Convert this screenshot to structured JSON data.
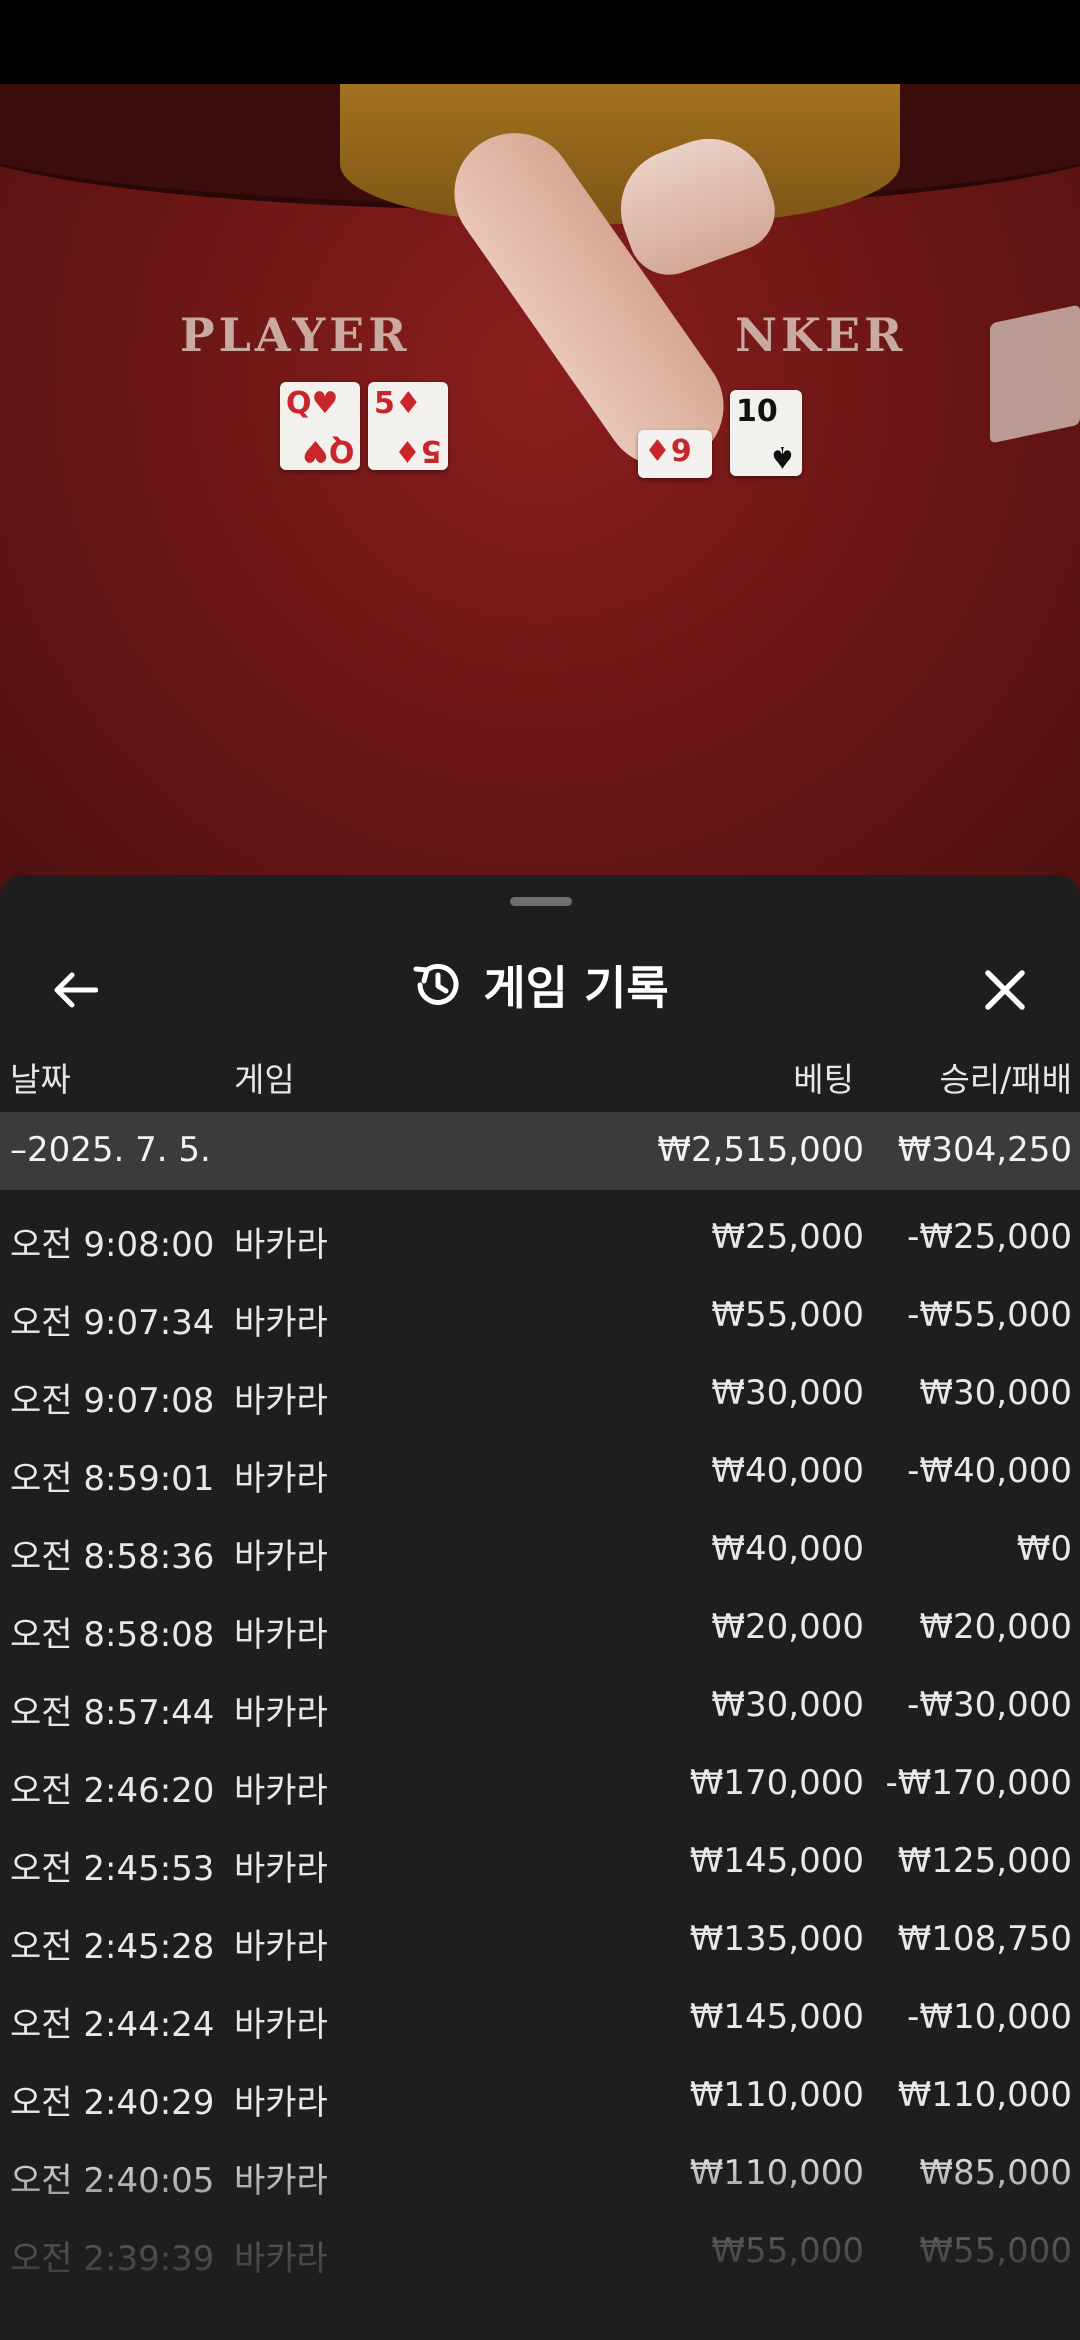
{
  "table": {
    "player_label": "PLAYER",
    "banker_label": "NKER",
    "player_cards": [
      {
        "rank": "Q",
        "suit": "♥",
        "color": "red"
      },
      {
        "rank": "5",
        "suit": "♦",
        "color": "red"
      }
    ],
    "banker_cards": [
      {
        "rank": "9",
        "suit": "♦",
        "color": "red"
      },
      {
        "rank": "10",
        "suit": "♠",
        "color": "black"
      }
    ]
  },
  "sheet": {
    "title": "게임 기록",
    "icons": {
      "back": "arrow-left-icon",
      "history": "history-icon",
      "close": "close-icon"
    }
  },
  "columns": {
    "date": "날짜",
    "game": "게임",
    "bet": "베팅",
    "result": "승리/패배"
  },
  "summary": {
    "date": "–2025. 7. 5.",
    "bet": "₩2,515,000",
    "result": "₩304,250"
  },
  "rows": [
    {
      "time": "오전 9:08:00",
      "game": "바카라",
      "bet": "₩25,000",
      "result": "-₩25,000"
    },
    {
      "time": "오전 9:07:34",
      "game": "바카라",
      "bet": "₩55,000",
      "result": "-₩55,000"
    },
    {
      "time": "오전 9:07:08",
      "game": "바카라",
      "bet": "₩30,000",
      "result": "₩30,000"
    },
    {
      "time": "오전 8:59:01",
      "game": "바카라",
      "bet": "₩40,000",
      "result": "-₩40,000"
    },
    {
      "time": "오전 8:58:36",
      "game": "바카라",
      "bet": "₩40,000",
      "result": "₩0"
    },
    {
      "time": "오전 8:58:08",
      "game": "바카라",
      "bet": "₩20,000",
      "result": "₩20,000"
    },
    {
      "time": "오전 8:57:44",
      "game": "바카라",
      "bet": "₩30,000",
      "result": "-₩30,000"
    },
    {
      "time": "오전 2:46:20",
      "game": "바카라",
      "bet": "₩170,000",
      "result": "-₩170,000"
    },
    {
      "time": "오전 2:45:53",
      "game": "바카라",
      "bet": "₩145,000",
      "result": "₩125,000"
    },
    {
      "time": "오전 2:45:28",
      "game": "바카라",
      "bet": "₩135,000",
      "result": "₩108,750"
    },
    {
      "time": "오전 2:44:24",
      "game": "바카라",
      "bet": "₩145,000",
      "result": "-₩10,000"
    },
    {
      "time": "오전 2:40:29",
      "game": "바카라",
      "bet": "₩110,000",
      "result": "₩110,000"
    },
    {
      "time": "오전 2:40:05",
      "game": "바카라",
      "bet": "₩110,000",
      "result": "₩85,000"
    },
    {
      "time": "오전 2:39:39",
      "game": "바카라",
      "bet": "₩55,000",
      "result": "₩55,000"
    }
  ]
}
